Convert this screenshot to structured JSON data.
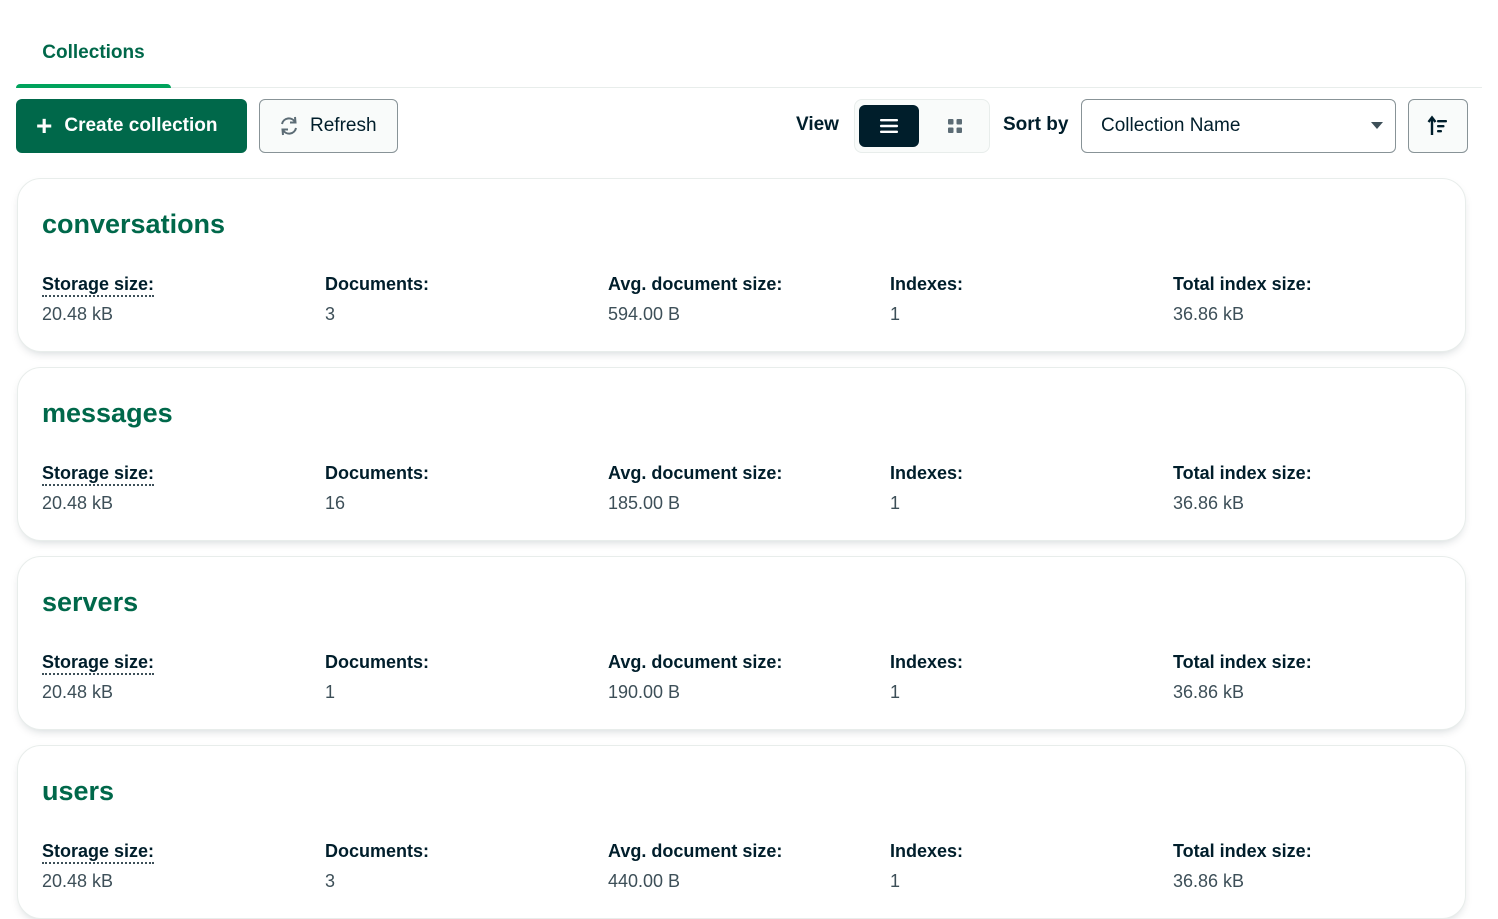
{
  "tabs": [
    {
      "label": "Collections",
      "active": true
    }
  ],
  "toolbar": {
    "create_label": "Create collection",
    "refresh_label": "Refresh",
    "view_label": "View",
    "sort_label": "Sort by",
    "sort_value": "Collection Name",
    "active_view": "list"
  },
  "colors": {
    "brand_green": "#00684a",
    "accent_green": "#00a35c",
    "dark": "#001e2b"
  },
  "stat_labels": {
    "storage": "Storage size:",
    "documents": "Documents:",
    "avg": "Avg. document size:",
    "indexes": "Indexes:",
    "total_index": "Total index size:"
  },
  "collections": [
    {
      "name": "conversations",
      "storage": "20.48 kB",
      "documents": "3",
      "avg": "594.00 B",
      "indexes": "1",
      "total_index": "36.86 kB"
    },
    {
      "name": "messages",
      "storage": "20.48 kB",
      "documents": "16",
      "avg": "185.00 B",
      "indexes": "1",
      "total_index": "36.86 kB"
    },
    {
      "name": "servers",
      "storage": "20.48 kB",
      "documents": "1",
      "avg": "190.00 B",
      "indexes": "1",
      "total_index": "36.86 kB"
    },
    {
      "name": "users",
      "storage": "20.48 kB",
      "documents": "3",
      "avg": "440.00 B",
      "indexes": "1",
      "total_index": "36.86 kB"
    }
  ]
}
